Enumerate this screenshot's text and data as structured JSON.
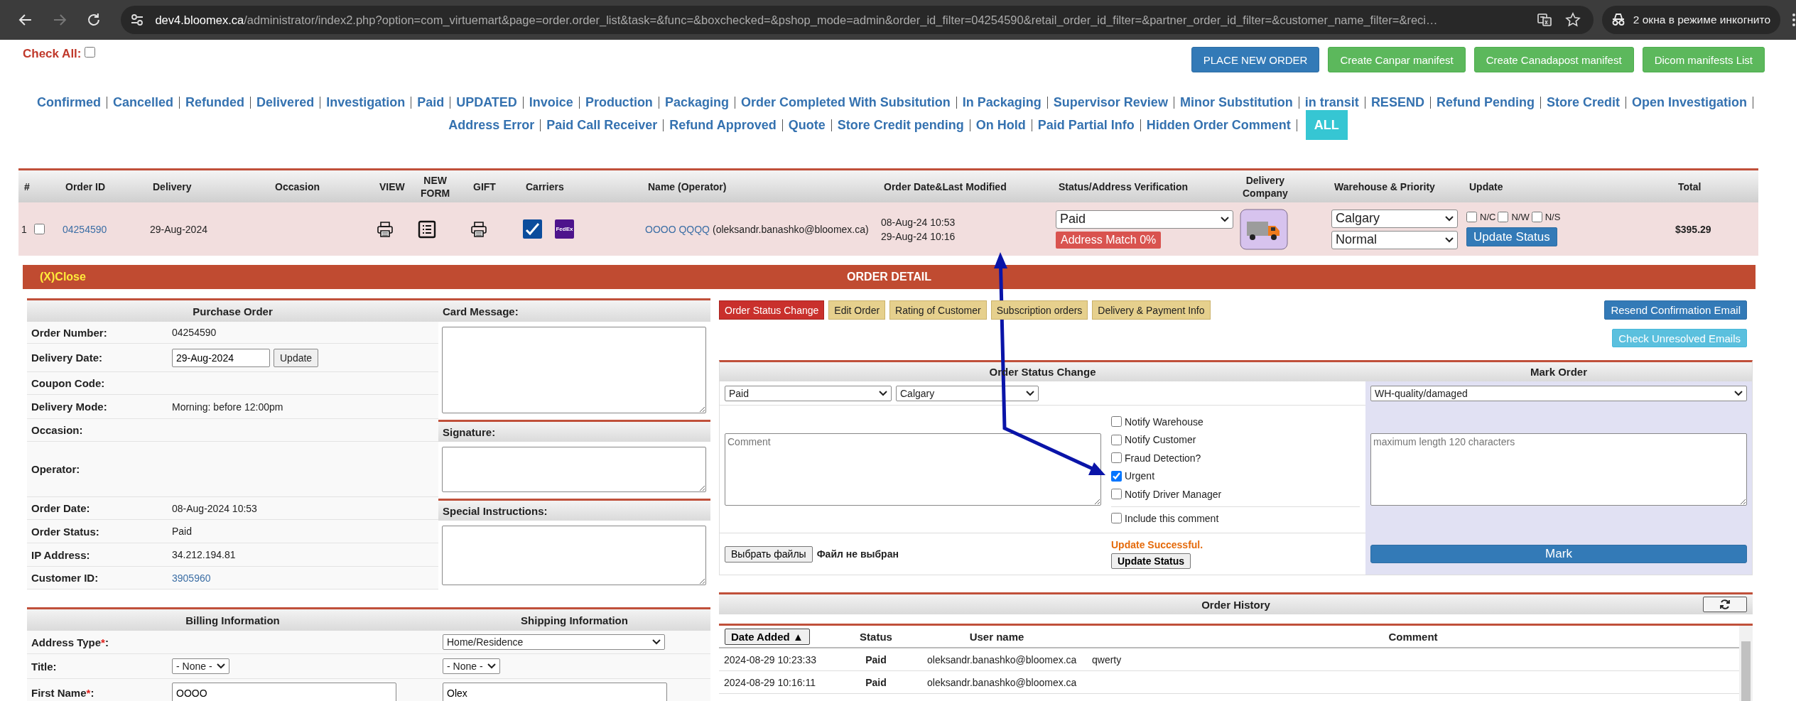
{
  "browser": {
    "url_host": "dev4.bloomex.ca",
    "url_path": "/administrator/index2.php?option=com_virtuemart&page=order.order_list&task=&func=&boxchecked=&pshop_mode=admin&order_id_filter=04254590&retail_order_id_filter=&partner_order_id_filter=&customer_name_filter=&reci…",
    "incognito_label": "2 окна в режиме инкогнито"
  },
  "check_all": {
    "label": "Check All:",
    "checked": false
  },
  "action_buttons": [
    {
      "label": "PLACE NEW ORDER",
      "kind": "primary"
    },
    {
      "label": "Create Canpar manifest",
      "kind": "success"
    },
    {
      "label": "Create Canadapost manifest",
      "kind": "success"
    },
    {
      "label": "Dicom manifests List",
      "kind": "success"
    }
  ],
  "status_filters": [
    [
      {
        "label": "Confirmed",
        "selected": false
      },
      {
        "label": "Cancelled",
        "selected": false
      },
      {
        "label": "Refunded",
        "selected": false
      },
      {
        "label": "Delivered",
        "selected": false
      },
      {
        "label": "Investigation",
        "selected": false
      },
      {
        "label": "Paid",
        "selected": false
      },
      {
        "label": "UPDATED",
        "selected": false
      },
      {
        "label": "Invoice",
        "selected": false
      },
      {
        "label": "Production",
        "selected": false
      },
      {
        "label": "Packaging",
        "selected": false
      },
      {
        "label": "Order Completed With Subsitution",
        "selected": false
      },
      {
        "label": "In Packaging",
        "selected": false
      },
      {
        "label": "Supervisor Review",
        "selected": false
      },
      {
        "label": "Minor Substitution",
        "selected": false
      },
      {
        "label": "in transit",
        "selected": false
      },
      {
        "label": "RESEND",
        "selected": false
      },
      {
        "label": "Refund Pending",
        "selected": false
      },
      {
        "label": "Store Credit",
        "selected": false
      },
      {
        "label": "Open Investigation",
        "selected": false
      }
    ],
    [
      {
        "label": "Address Error",
        "selected": false
      },
      {
        "label": "Paid Call Receiver",
        "selected": false
      },
      {
        "label": "Refund Approved",
        "selected": false
      },
      {
        "label": "Quote",
        "selected": false
      },
      {
        "label": "Store Credit pending",
        "selected": false
      },
      {
        "label": "On Hold",
        "selected": false
      },
      {
        "label": "Paid Partial Info",
        "selected": false
      },
      {
        "label": "Hidden Order Comment",
        "selected": false
      },
      {
        "label": "ALL",
        "selected": true
      }
    ]
  ],
  "orders": {
    "columns": [
      "#",
      "Order ID",
      "Delivery",
      "Occasion",
      "VIEW",
      "NEW FORM",
      "GIFT",
      "Carriers",
      "Name (Operator)",
      "Order Date&Last Modified",
      "Status/Address Verification",
      "Delivery Company",
      "Warehouse & Priority",
      "Update",
      "Total"
    ],
    "rows": [
      {
        "number": "1",
        "checked": false,
        "order_id": "04254590",
        "delivery": "29-Aug-2024",
        "carriers": [
          {
            "kind": "check"
          },
          {
            "kind": "fedex",
            "label": "FedEx"
          }
        ],
        "customer": "OOOO QQQQ",
        "operator": "(oleksandr.banashko@bloomex.ca)",
        "order_date": "08-Aug-24 10:53",
        "modified": "29-Aug-24 10:16",
        "status": "Paid",
        "address_match": "Address Match 0%",
        "warehouse": "Calgary",
        "priority": "Normal",
        "flags": [
          {
            "label": "N/C",
            "checked": false
          },
          {
            "label": "N/W",
            "checked": false
          },
          {
            "label": "N/S",
            "checked": false
          }
        ],
        "update_button": "Update Status",
        "total": "$395.29"
      }
    ]
  },
  "order_detail": {
    "close": "(X)Close",
    "title": "ORDER DETAIL"
  },
  "purchase_order": {
    "title": "Purchase Order",
    "fields": [
      {
        "label": "Order Number:",
        "kind": "text",
        "value": "04254590"
      },
      {
        "label": "Delivery Date:",
        "kind": "date",
        "value": "29-Aug-2024",
        "button": "Update"
      },
      {
        "label": "Coupon Code:",
        "kind": "empty"
      },
      {
        "label": "Delivery Mode:",
        "kind": "text",
        "value": "Morning: before 12:00pm"
      },
      {
        "label": "Occasion:",
        "kind": "empty"
      },
      {
        "label": "Operator:",
        "kind": "empty"
      },
      {
        "label": "Order Date:",
        "kind": "text",
        "value": "08-Aug-2024 10:53"
      },
      {
        "label": "Order Status:",
        "kind": "text",
        "value": "Paid"
      },
      {
        "label": "IP Address:",
        "kind": "text",
        "value": "34.212.194.81"
      },
      {
        "label": "Customer ID:",
        "kind": "link",
        "value": "3905960"
      }
    ]
  },
  "notes": [
    {
      "title": "Card Message:"
    },
    {
      "title": "Signature:"
    },
    {
      "title": "Special Instructions:"
    }
  ],
  "address": {
    "billing_title": "Billing Information",
    "shipping_title": "Shipping Information",
    "fields": [
      {
        "label": "Address Type",
        "required_mark": "*",
        "suffix": ":",
        "shipping": {
          "kind": "select",
          "value": "Home/Residence"
        }
      },
      {
        "label": "Title:",
        "billing": {
          "kind": "select",
          "value": "- None -"
        },
        "shipping": {
          "kind": "select",
          "value": "- None -"
        }
      },
      {
        "label": "First Name",
        "required_mark": "*",
        "suffix": ":",
        "billing": {
          "kind": "input",
          "value": "OOOO"
        },
        "shipping": {
          "kind": "input",
          "value": "Olex"
        }
      }
    ]
  },
  "tabs": [
    {
      "label": "Order Status Change",
      "selected": true
    },
    {
      "label": "Edit Order",
      "selected": false
    },
    {
      "label": "Rating of Customer",
      "selected": false
    },
    {
      "label": "Subscription orders",
      "selected": false
    },
    {
      "label": "Delivery & Payment Info",
      "selected": false
    }
  ],
  "side_buttons": [
    {
      "label": "Resend Confirmation Email",
      "kind": "primary"
    },
    {
      "label": "Check Unresolved Emails",
      "kind": "info"
    }
  ],
  "status_change": {
    "title": "Order Status Change",
    "status": "Paid",
    "warehouse": "Calgary",
    "comment_placeholder": "Comment",
    "notifications": [
      {
        "label": "Notify Warehouse",
        "checked": false
      },
      {
        "label": "Notify Customer",
        "checked": false
      },
      {
        "label": "Fraud Detection?",
        "checked": false
      },
      {
        "label": "Urgent",
        "checked": true
      },
      {
        "label": "Notify Driver Manager",
        "checked": false
      }
    ],
    "include_comment": {
      "label": "Include this comment",
      "checked": false
    },
    "file_button": "Выбрать файлы",
    "file_status": "Файл не выбран",
    "message": "Update Successful.",
    "update_button": "Update Status"
  },
  "mark_order": {
    "title": "Mark Order",
    "reason": "WH-quality/damaged",
    "placeholder": "maximum length 120 characters",
    "button": "Mark"
  },
  "history": {
    "title": "Order History",
    "columns": [
      "Date Added ▲",
      "Status",
      "User name",
      "Comment"
    ],
    "rows": [
      {
        "date": "2024-08-29 10:23:33",
        "status": "Paid",
        "user": "oleksandr.banashko@bloomex.ca",
        "comment": "qwerty"
      },
      {
        "date": "2024-08-29 10:16:11",
        "status": "Paid",
        "user": "oleksandr.banashko@bloomex.ca"
      }
    ]
  }
}
